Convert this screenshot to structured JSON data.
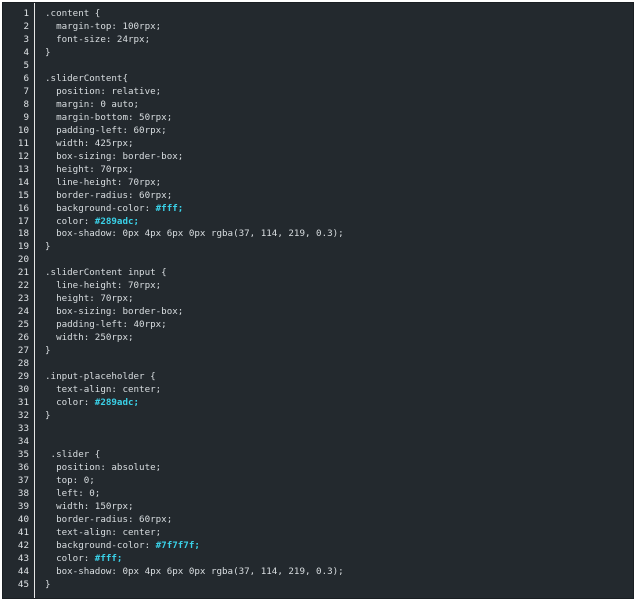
{
  "editor": {
    "language": "css",
    "lines": [
      {
        "n": "1",
        "text": ".content {",
        "value": ""
      },
      {
        "n": "2",
        "text": "  margin-top: 100rpx;",
        "value": ""
      },
      {
        "n": "3",
        "text": "  font-size: 24rpx;",
        "value": ""
      },
      {
        "n": "4",
        "text": "}",
        "value": ""
      },
      {
        "n": "5",
        "text": "",
        "value": ""
      },
      {
        "n": "6",
        "text": ".sliderContent{",
        "value": ""
      },
      {
        "n": "7",
        "text": "  position: relative;",
        "value": ""
      },
      {
        "n": "8",
        "text": "  margin: 0 auto;",
        "value": ""
      },
      {
        "n": "9",
        "text": "  margin-bottom: 50rpx;",
        "value": ""
      },
      {
        "n": "10",
        "text": "  padding-left: 60rpx;",
        "value": ""
      },
      {
        "n": "11",
        "text": "  width: 425rpx;",
        "value": ""
      },
      {
        "n": "12",
        "text": "  box-sizing: border-box;",
        "value": ""
      },
      {
        "n": "13",
        "text": "  height: 70rpx;",
        "value": ""
      },
      {
        "n": "14",
        "text": "  line-height: 70rpx;",
        "value": ""
      },
      {
        "n": "15",
        "text": "  border-radius: 60rpx;",
        "value": ""
      },
      {
        "n": "16",
        "text": "  background-color: ",
        "value": "#fff;"
      },
      {
        "n": "17",
        "text": "  color: ",
        "value": "#289adc;"
      },
      {
        "n": "18",
        "text": "  box-shadow: 0px 4px 6px 0px rgba(37, 114, 219, 0.3);",
        "value": ""
      },
      {
        "n": "19",
        "text": "}",
        "value": ""
      },
      {
        "n": "20",
        "text": "",
        "value": ""
      },
      {
        "n": "21",
        "text": ".sliderContent input {",
        "value": ""
      },
      {
        "n": "22",
        "text": "  line-height: 70rpx;",
        "value": ""
      },
      {
        "n": "23",
        "text": "  height: 70rpx;",
        "value": ""
      },
      {
        "n": "24",
        "text": "  box-sizing: border-box;",
        "value": ""
      },
      {
        "n": "25",
        "text": "  padding-left: 40rpx;",
        "value": ""
      },
      {
        "n": "26",
        "text": "  width: 250rpx;",
        "value": ""
      },
      {
        "n": "27",
        "text": "}",
        "value": ""
      },
      {
        "n": "28",
        "text": "",
        "value": ""
      },
      {
        "n": "29",
        "text": ".input-placeholder {",
        "value": ""
      },
      {
        "n": "30",
        "text": "  text-align: center;",
        "value": ""
      },
      {
        "n": "31",
        "text": "  color: ",
        "value": "#289adc;"
      },
      {
        "n": "32",
        "text": "}",
        "value": ""
      },
      {
        "n": "33",
        "text": "",
        "value": ""
      },
      {
        "n": "34",
        "text": "",
        "value": ""
      },
      {
        "n": "35",
        "text": " .slider {",
        "value": ""
      },
      {
        "n": "36",
        "text": "  position: absolute;",
        "value": ""
      },
      {
        "n": "37",
        "text": "  top: 0;",
        "value": ""
      },
      {
        "n": "38",
        "text": "  left: 0;",
        "value": ""
      },
      {
        "n": "39",
        "text": "  width: 150rpx;",
        "value": ""
      },
      {
        "n": "40",
        "text": "  border-radius: 60rpx;",
        "value": ""
      },
      {
        "n": "41",
        "text": "  text-align: center;",
        "value": ""
      },
      {
        "n": "42",
        "text": "  background-color: ",
        "value": "#7f7f7f;"
      },
      {
        "n": "43",
        "text": "  color: ",
        "value": "#fff;"
      },
      {
        "n": "44",
        "text": "  box-shadow: 0px 4px 6px 0px rgba(37, 114, 219, 0.3);",
        "value": ""
      },
      {
        "n": "45",
        "text": "}",
        "value": ""
      }
    ]
  },
  "colors": {
    "background": "#23292e",
    "text": "#d8dde0",
    "highlight": "#3ad1e8",
    "line_number": "#dfe3e6"
  }
}
